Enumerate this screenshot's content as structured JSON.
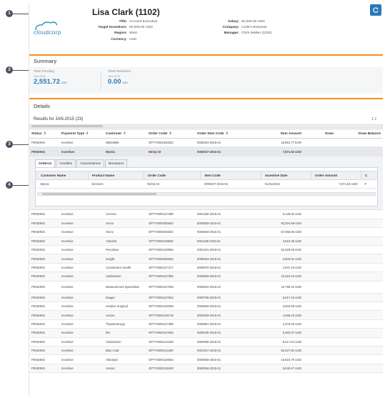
{
  "callouts": [
    "1",
    "2",
    "3",
    "4"
  ],
  "employee": {
    "name": "Lisa Clark (1102)",
    "logo_text": "cloudcorp",
    "left_fields": [
      {
        "label": "Title:",
        "value": "Account Executive"
      },
      {
        "label": "Target Incentives:",
        "value": "60,000.00 USD"
      },
      {
        "label": "Region:",
        "value": "West"
      },
      {
        "label": "Currency:",
        "value": "USD"
      }
    ],
    "right_fields": [
      {
        "label": "Salary:",
        "value": "60,000.00 USD"
      },
      {
        "label": "Company:",
        "value": "Code's Business"
      },
      {
        "label": "Manager:",
        "value": "Chris Walker (1100)"
      }
    ]
  },
  "summary": {
    "title": "Summary",
    "items": [
      {
        "label": "Total Pending",
        "period": "JAN-2015",
        "amount": "2,551.72",
        "currency": "USD"
      },
      {
        "label": "Total Released",
        "period": "JAN-2015",
        "amount": "0.00",
        "currency": "USD"
      }
    ]
  },
  "details": {
    "title": "Details",
    "results_label": "Results for JAN-2015 (23)",
    "pager": "1 2",
    "columns": [
      "Status",
      "Payment Type",
      "Customer",
      "Order Code",
      "Order Item Code",
      "Item Amount",
      "Draw",
      "Draw Balance"
    ],
    "sortable": [
      true,
      true,
      true,
      true,
      true,
      false,
      false,
      false
    ],
    "first_rows": [
      {
        "status": "PENDING",
        "type": "Incentive",
        "customer": "MEDIBBK",
        "order": "OPTY0001926262",
        "item": "0000281-2015-01",
        "amount": "10,891.77 EUR"
      },
      {
        "status": "PENDING",
        "type": "Incentive",
        "customer": "Mymix",
        "order": "NeOp-10",
        "item": "0000027-2015-01",
        "amount": "7,571.53 USD"
      }
    ],
    "rows": [
      {
        "status": "PENDING",
        "type": "Incentive",
        "customer": "LiveVox",
        "order": "OPTY0000127289",
        "item": "0001459-2015-01",
        "amount": "5,136.00 USD"
      },
      {
        "status": "PENDING",
        "type": "Incentive",
        "customer": "Xerox",
        "order": "OPTY0000025502",
        "item": "0000583-2015-01",
        "amount": "92,304.59 USD"
      },
      {
        "status": "PENDING",
        "type": "Incentive",
        "customer": "Xerox",
        "order": "OPTY0000025502",
        "item": "0000584-2015-01",
        "amount": "67,066.85 USD"
      },
      {
        "status": "PENDING",
        "type": "Incentive",
        "customer": "Yamaha",
        "order": "OPTY0000128845",
        "item": "0001196-2015-01",
        "amount": "3,915.36 USD"
      },
      {
        "status": "PENDING",
        "type": "Incentive",
        "customer": "Pervasive",
        "order": "OPTY0000128906",
        "item": "0001231-2015-01",
        "amount": "52,329.93 USD"
      },
      {
        "status": "PENDING",
        "type": "Incentive",
        "customer": "Insight",
        "order": "OPTY0000026062",
        "item": "0000064-2015-01",
        "amount": "3,503.91 USD"
      },
      {
        "status": "PENDING",
        "type": "Incentive",
        "customer": "Curestream Health",
        "order": "OPTY0000127217",
        "item": "0000670-2015-01",
        "amount": "4,947.19 USD"
      },
      {
        "status": "PENDING",
        "type": "Incentive",
        "customer": "Cablevision",
        "order": "OPTY0000127355",
        "item": "0000983-2015-01",
        "amount": "10,322.23 USD"
      },
      {
        "status": "PENDING",
        "type": "Incentive",
        "customer": "Measurement Specialties",
        "order": "OPTY0000127038",
        "item": "0000910-2015-01",
        "amount": "10,798.44 USD",
        "tall": true
      },
      {
        "status": "PENDING",
        "type": "Incentive",
        "customer": "Dr●ger",
        "order": "OPTY0000127923",
        "item": "0000796-2015-01",
        "amount": "6,517.16 USD"
      },
      {
        "status": "PENDING",
        "type": "Incentive",
        "customer": "Intuitive Surgical",
        "order": "OPTY0000128359",
        "item": "0000693-2015-01",
        "amount": "3,504.69 USD"
      },
      {
        "status": "PENDING",
        "type": "Incentive",
        "customer": "Ascion",
        "order": "OPTY0000128719",
        "item": "0000093-2015-01",
        "amount": "4,496.43 USD"
      },
      {
        "status": "PENDING",
        "type": "Incentive",
        "customer": "ThyssenKrupp",
        "order": "OPTY0000127389",
        "item": "0000961-2015-01",
        "amount": "3,376.26 USD"
      },
      {
        "status": "PENDING",
        "type": "Incentive",
        "customer": "Bio",
        "order": "OPTY0000127835",
        "item": "0000235-2015-01",
        "amount": "5,482.07 USD"
      },
      {
        "status": "PENDING",
        "type": "Incentive",
        "customer": "Cablevision",
        "order": "OPTY0000124346",
        "item": "0000980-2015-01",
        "amount": "-5,417.64 USD"
      },
      {
        "status": "PENDING",
        "type": "Incentive",
        "customer": "Blue Coat",
        "order": "OPTY0000124490",
        "item": "0001047-2015-01",
        "amount": "50,227.82 USD"
      },
      {
        "status": "PENDING",
        "type": "Incentive",
        "customer": "Allscripts",
        "order": "OPTY0000128053",
        "item": "0000893-2015-01",
        "amount": "16,823.79 USD"
      },
      {
        "status": "PENDING",
        "type": "Incentive",
        "customer": "Ascion",
        "order": "OPTY0000125190",
        "item": "0000094-2015-01",
        "amount": "5,040.47 USD"
      }
    ]
  },
  "nested": {
    "tabs": [
      "Orders1",
      "Credits1",
      "Commissions",
      "Bonuses1"
    ],
    "columns": [
      "Customer Name",
      "Product Name",
      "Order Code",
      "Item Code",
      "Incentive Date",
      "Order Amount",
      "C"
    ],
    "row": [
      "Mymix",
      "Services",
      "NeOp-10",
      "0000027-2015-01",
      "01/31/2015",
      "7,571.53 USD",
      "F"
    ]
  },
  "colors": {
    "accent": "#2a7ab8",
    "rule": "#f3901d",
    "callout": "#4a5160"
  }
}
